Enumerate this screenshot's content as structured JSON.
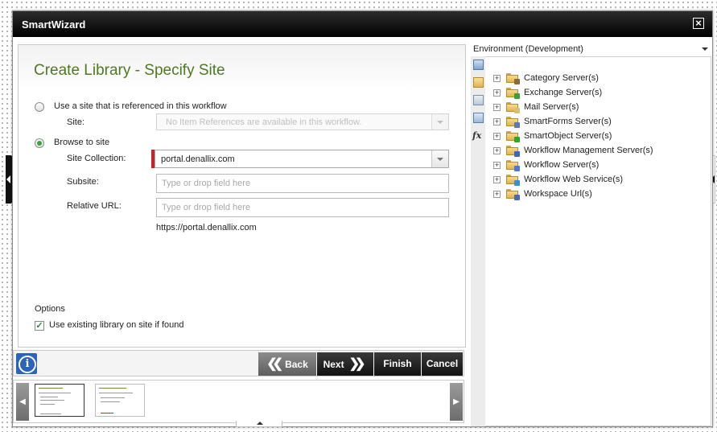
{
  "window": {
    "title": "SmartWizard",
    "close_icon": "close-icon"
  },
  "wizard": {
    "page_title": "Create Library - Specify Site",
    "option_reference": {
      "label": "Use a site that is referenced in this workflow",
      "selected": false,
      "site_label": "Site:",
      "site_placeholder": "No Item References are available in this workflow."
    },
    "option_browse": {
      "label": "Browse to site",
      "selected": true,
      "site_collection_label": "Site Collection:",
      "site_collection_value": "portal.denallix.com",
      "subsite_label": "Subsite:",
      "subsite_placeholder": "Type or drop field here",
      "relative_url_label": "Relative URL:",
      "relative_url_placeholder": "Type or drop field here",
      "resolved_url": "https://portal.denallix.com"
    },
    "options_heading": "Options",
    "use_existing_label": "Use existing library on site if found",
    "use_existing_checked": true
  },
  "buttons": {
    "back": "Back",
    "next": "Next",
    "finish": "Finish",
    "cancel": "Cancel"
  },
  "environment": {
    "title": "Environment (Development)",
    "tree": [
      {
        "label": "Category Server(s)",
        "icon": "category-server-icon",
        "badge": "#8a6a3a"
      },
      {
        "label": "Exchange Server(s)",
        "icon": "exchange-server-icon",
        "badge": "#3aa03a"
      },
      {
        "label": "Mail Server(s)",
        "icon": "mail-server-icon",
        "badge": "#d8c070"
      },
      {
        "label": "SmartForms Server(s)",
        "icon": "smartforms-server-icon",
        "badge": "#5a7ab0"
      },
      {
        "label": "SmartObject Server(s)",
        "icon": "smartobject-server-icon",
        "badge": "#2fa52f"
      },
      {
        "label": "Workflow Management Server(s)",
        "icon": "workflow-management-server-icon",
        "badge": "#3a6ac0"
      },
      {
        "label": "Workflow Server(s)",
        "icon": "workflow-server-icon",
        "badge": "#4a7ad0"
      },
      {
        "label": "Workflow Web Service(s)",
        "icon": "workflow-web-service-icon",
        "badge": "#3b8fd8"
      },
      {
        "label": "Workspace Url(s)",
        "icon": "workspace-url-icon",
        "badge": "#4a6ac0"
      }
    ]
  },
  "colors": {
    "title_green": "#4b7a1e",
    "required_marker": "#c0272d",
    "info_blue": "#2b64b8"
  }
}
